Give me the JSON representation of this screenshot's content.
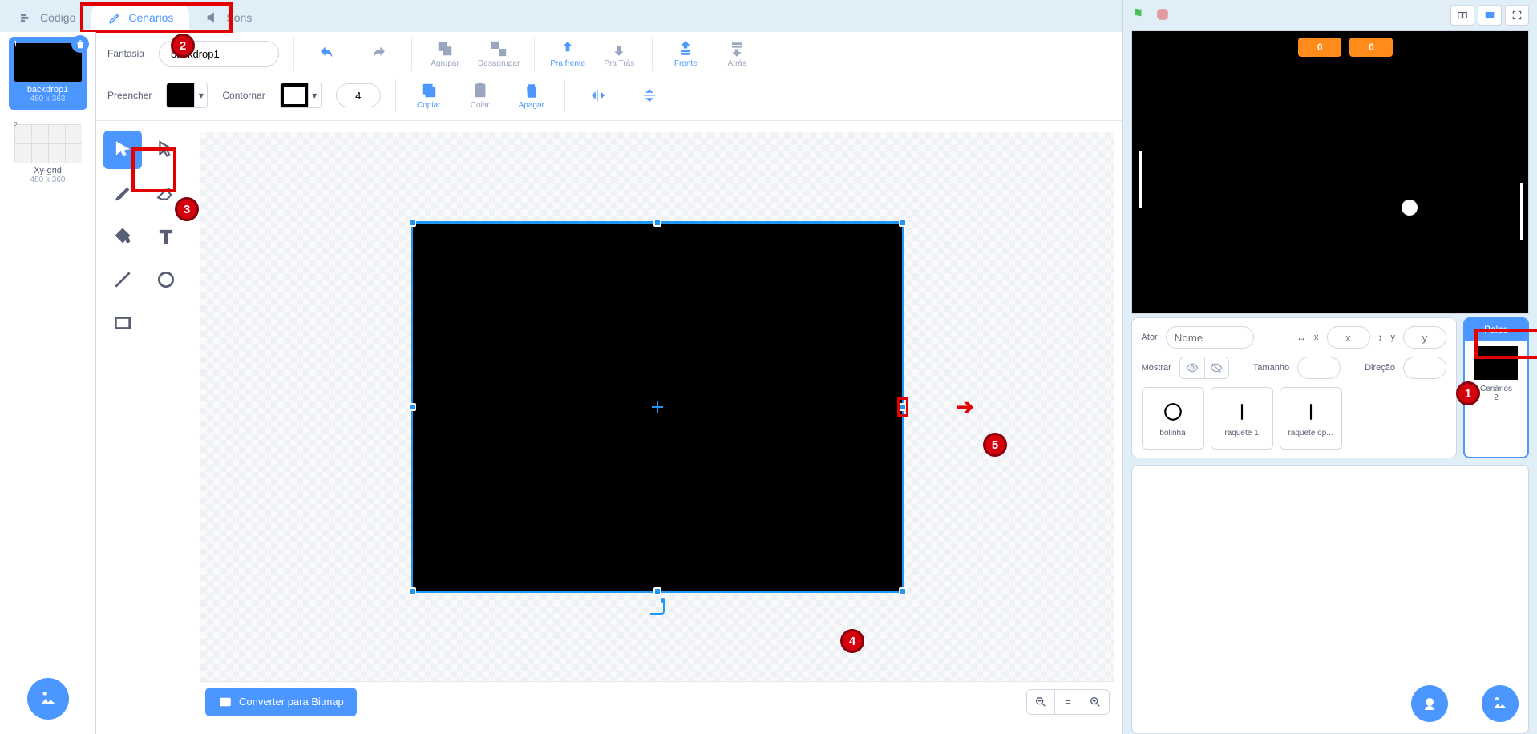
{
  "tabs": {
    "code": "Código",
    "costumes": "Cenários",
    "sounds": "Sons"
  },
  "costumes": [
    {
      "idx": "1",
      "name": "backdrop1",
      "dims": "480 x 363"
    },
    {
      "idx": "2",
      "name": "Xy-grid",
      "dims": "480 x 360"
    }
  ],
  "paint": {
    "costume_label": "Fantasia",
    "costume_name": "backdrop1",
    "group": "Agrupar",
    "ungroup": "Desagrupar",
    "forward": "Pra frente",
    "backward": "Pra Trás",
    "front": "Frente",
    "back": "Atrás",
    "fill_label": "Preencher",
    "outline_label": "Contornar",
    "outline_width": "4",
    "copy": "Copiar",
    "paste": "Colar",
    "delete": "Apagar",
    "convert": "Converter para Bitmap"
  },
  "sprite_info": {
    "label": "Ator",
    "name_placeholder": "Nome",
    "x_label": "x",
    "x_placeholder": "x",
    "y_label": "y",
    "y_placeholder": "y",
    "show_label": "Mostrar",
    "size_label": "Tamanho",
    "dir_label": "Direção"
  },
  "stage_tile": {
    "title": "Palco",
    "label": "Cenários",
    "count": "2"
  },
  "sprites": [
    {
      "name": "bolinha"
    },
    {
      "name": "raquete 1"
    },
    {
      "name": "raquete op..."
    }
  ],
  "stage": {
    "score_left": "0",
    "score_right": "0"
  },
  "markers": {
    "m1": "1",
    "m2": "2",
    "m3": "3",
    "m4": "4",
    "m5": "5"
  }
}
